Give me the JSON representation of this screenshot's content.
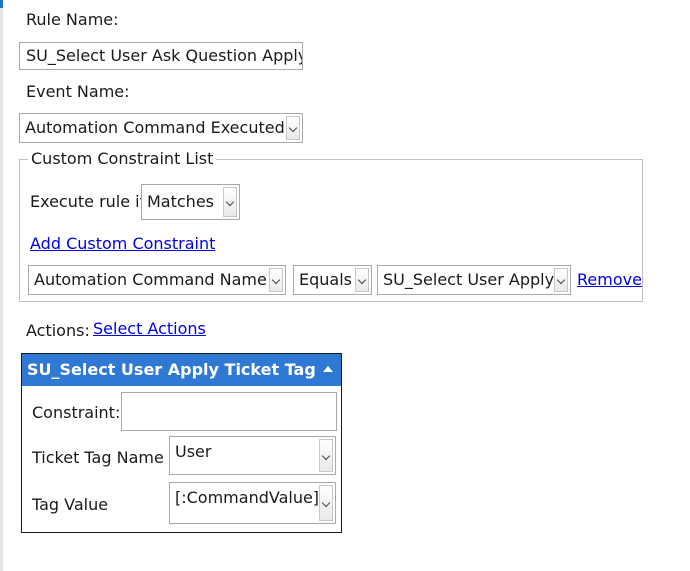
{
  "rule_name": {
    "label": "Rule Name:",
    "value": "SU_Select User Ask Question Apply"
  },
  "event_name": {
    "label": "Event Name:",
    "selected": "Automation Command Executed"
  },
  "constraint_list": {
    "legend": "Custom Constraint List",
    "execute_label": "Execute rule if",
    "execute_selected": "Matches",
    "add_link": "Add Custom Constraint",
    "row": {
      "field_selected": "Automation Command Name",
      "operator_selected": "Equals",
      "value_selected": "SU_Select User Apply",
      "remove_link": "Remove"
    }
  },
  "actions": {
    "label": "Actions:",
    "select_link": "Select Actions",
    "panel": {
      "title": "SU_Select User Apply Ticket Tag",
      "header_color": "#2f79d4",
      "constraint_label": "Constraint:",
      "constraint_value": "",
      "tag_name_label": "Ticket Tag Name",
      "tag_name_selected": "User",
      "tag_value_label": "Tag Value",
      "tag_value_selected": "[:CommandValue]"
    }
  },
  "colors": {
    "link": "#0000ee",
    "accent": "#1f73c8"
  }
}
